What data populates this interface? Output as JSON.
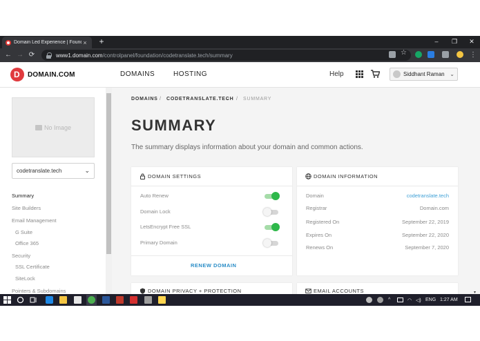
{
  "browser": {
    "tab_title": "Domain Led Experience | Foundation",
    "tab_close": "×",
    "new_tab": "+",
    "url_host": "www1.domain.com",
    "url_path": "/controlpanel/foundation/codetranslate.tech/summary",
    "window_minimize": "–",
    "window_maximize": "❐",
    "window_close": "✕"
  },
  "header": {
    "logo_text": "DOMAIN.COM",
    "nav_domains": "DOMAINS",
    "nav_hosting": "HOSTING",
    "help": "Help",
    "user_name": "Siddhant Raman"
  },
  "sidebar": {
    "no_image": "No Image",
    "domain_select": "codetranslate.tech",
    "items": [
      {
        "label": "Summary",
        "active": true
      },
      {
        "label": "Site Builders"
      },
      {
        "label": "Email Management"
      },
      {
        "label": "G Suite"
      },
      {
        "label": "Office 365"
      },
      {
        "label": "Security"
      },
      {
        "label": "SSL Certificate"
      },
      {
        "label": "SiteLock"
      },
      {
        "label": "Pointers & Subdomains"
      }
    ]
  },
  "breadcrumb": {
    "root": "DOMAINS",
    "sep": "/",
    "domain": "CODETRANSLATE.TECH",
    "current": "SUMMARY"
  },
  "page": {
    "title": "SUMMARY",
    "subtitle": "The summary displays information about your domain and common actions."
  },
  "domain_settings": {
    "title": "DOMAIN SETTINGS",
    "rows": [
      {
        "label": "Auto Renew",
        "on": true
      },
      {
        "label": "Domain Lock",
        "on": false
      },
      {
        "label": "LetsEncrypt Free SSL",
        "on": true
      },
      {
        "label": "Primary Domain",
        "on": false
      }
    ],
    "action": "RENEW DOMAIN"
  },
  "domain_information": {
    "title": "DOMAIN INFORMATION",
    "rows": [
      {
        "label": "Domain",
        "value": "codetranslate.tech"
      },
      {
        "label": "Registrar",
        "value": "Domain.com"
      },
      {
        "label": "Registered On",
        "value": "September 22, 2019"
      },
      {
        "label": "Expires On",
        "value": "September 22, 2020"
      },
      {
        "label": "Renews On",
        "value": "September 7, 2020"
      }
    ]
  },
  "lower_cards": {
    "privacy_title": "DOMAIN PRIVACY + PROTECTION",
    "email_title": "EMAIL ACCOUNTS"
  },
  "taskbar": {
    "language": "ENG",
    "time": "1:27 AM"
  },
  "colors": {
    "brand": "#e03a3e",
    "toggle_on": "#2eb84a",
    "link": "#3fa0d6"
  }
}
